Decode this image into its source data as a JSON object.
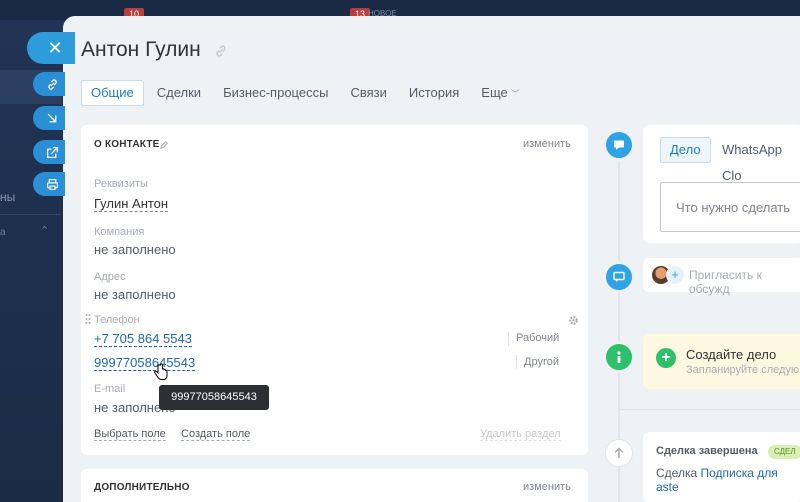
{
  "background": {
    "badge_1": "10",
    "badge_2": "13",
    "new_label": "НОВОЕ",
    "left_text": "ны",
    "left_text_2": "а"
  },
  "side_buttons": [
    {
      "icon": "close-icon"
    },
    {
      "icon": "link-icon"
    },
    {
      "icon": "arrow-down-right-icon"
    },
    {
      "icon": "external-link-icon"
    },
    {
      "icon": "print-icon"
    }
  ],
  "header": {
    "title": "Антон Гулин"
  },
  "tabs": [
    {
      "label": "Общие",
      "active": true
    },
    {
      "label": "Сделки"
    },
    {
      "label": "Бизнес-процессы"
    },
    {
      "label": "Связи"
    },
    {
      "label": "История"
    },
    {
      "label": "Еще"
    }
  ],
  "about": {
    "section_title": "О КОНТАКТЕ",
    "edit_label": "изменить",
    "fields": {
      "requisites_label": "Реквизиты",
      "requisites_value": "Гулин Антон",
      "company_label": "Компания",
      "company_value": "не заполнено",
      "address_label": "Адрес",
      "address_value": "не заполнено",
      "phone_label": "Телефон",
      "phone_1": "+7 705 864 5543",
      "phone_1_type": "Рабочий",
      "phone_2": "99977058645543",
      "phone_2_type": "Другой",
      "email_label": "E-mail",
      "email_value": "не заполнено"
    },
    "select_field": "Выбрать поле",
    "create_field": "Создать поле",
    "delete_section": "Удалить раздел",
    "tooltip": "99977058645543"
  },
  "additional": {
    "section_title": "ДОПОЛНИТЕЛЬНО",
    "edit_label": "изменить"
  },
  "timeline": {
    "tab_active": "Дело",
    "tab_whatsapp": "WhatsApp Clo",
    "todo_placeholder": "Что нужно сделать",
    "invite_text": "Пригласить к обсужд",
    "create_deal_title": "Создайте дело",
    "create_deal_sub": "Запланируйте следую",
    "closed_title": "Сделка завершена",
    "closed_badge": "СДЕЛ",
    "closed_deal_prefix": "Сделка",
    "closed_deal_link": "Подписка для aste"
  },
  "colors": {
    "accent": "#2fa3e6",
    "link": "#2067b0",
    "success": "#2fc06c",
    "panel_bg": "#eef2f4"
  }
}
